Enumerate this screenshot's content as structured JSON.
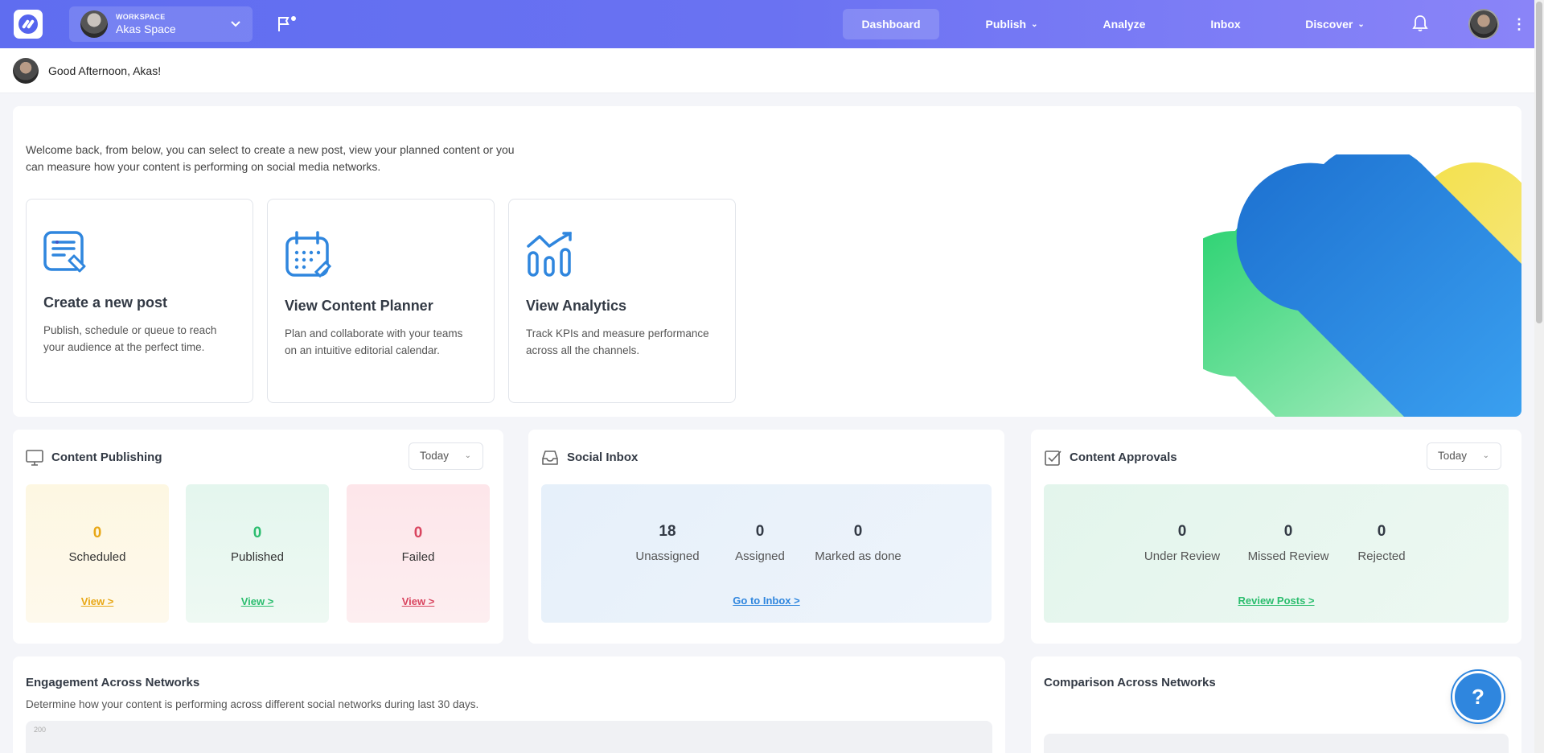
{
  "topnav": {
    "workspace_label": "WORKSPACE",
    "workspace_name": "Akas Space",
    "items": [
      {
        "label": "Dashboard",
        "active": true
      },
      {
        "label": "Publish",
        "has_dropdown": true
      },
      {
        "label": "Analyze"
      },
      {
        "label": "Inbox"
      },
      {
        "label": "Discover",
        "has_dropdown": true
      }
    ],
    "icons": [
      "logo-icon",
      "flag-icon",
      "bell-icon",
      "kebab-menu-icon"
    ]
  },
  "greeting": "Good Afternoon, Akas!",
  "welcome": {
    "text": "Welcome back, from below, you can select to create a new post, view your planned content or you can measure how your content is performing on social media networks.",
    "cards": [
      {
        "title": "Create a new post",
        "desc": "Publish, schedule or queue to reach your audience at the perfect time.",
        "icon": "create-post-icon"
      },
      {
        "title": "View Content Planner",
        "desc": "Plan and collaborate with your teams on an intuitive editorial calendar.",
        "icon": "calendar-icon"
      },
      {
        "title": "View Analytics",
        "desc": "Track KPIs and measure performance across all the channels.",
        "icon": "analytics-icon"
      }
    ]
  },
  "content_publishing": {
    "title": "Content Publishing",
    "filter": "Today",
    "stats": [
      {
        "value": "0",
        "label": "Scheduled",
        "link": "View >",
        "color": "#e8a715"
      },
      {
        "value": "0",
        "label": "Published",
        "link": "View >",
        "color": "#2bbd6e"
      },
      {
        "value": "0",
        "label": "Failed",
        "link": "View >",
        "color": "#d9455f"
      }
    ]
  },
  "social_inbox": {
    "title": "Social Inbox",
    "metrics": [
      {
        "value": "18",
        "label": "Unassigned"
      },
      {
        "value": "0",
        "label": "Assigned"
      },
      {
        "value": "0",
        "label": "Marked as done"
      }
    ],
    "link": "Go to Inbox >"
  },
  "content_approvals": {
    "title": "Content Approvals",
    "filter": "Today",
    "metrics": [
      {
        "value": "0",
        "label": "Under Review"
      },
      {
        "value": "0",
        "label": "Missed Review"
      },
      {
        "value": "0",
        "label": "Rejected"
      }
    ],
    "link": "Review Posts >"
  },
  "engagement": {
    "title": "Engagement Across Networks",
    "subtitle": "Determine how your content is performing across different social networks during last 30 days.",
    "tick": "200"
  },
  "comparison": {
    "title": "Comparison Across Networks"
  },
  "help": "?"
}
